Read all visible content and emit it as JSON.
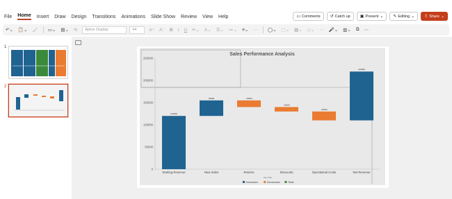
{
  "menu": [
    "File",
    "Home",
    "Insert",
    "Draw",
    "Design",
    "Transitions",
    "Animations",
    "Slide Show",
    "Review",
    "View",
    "Help"
  ],
  "menu_active": "Home",
  "top_right": {
    "comments": "Comments",
    "catchup": "Catch up",
    "present": "Present",
    "editing": "Editing",
    "share": "Share"
  },
  "ribbon": {
    "font_name": "Aptos Display",
    "font_size": "44"
  },
  "thumbnails": [
    {
      "number": "1"
    },
    {
      "number": "2"
    }
  ],
  "colors": {
    "increase": "#1f6391",
    "decrease": "#ea7b32",
    "total": "#3b8a3b",
    "accent": "#c43e1c"
  },
  "chart_data": {
    "type": "bar",
    "subtype": "waterfall",
    "title": "Sales Performance Analysis",
    "xlabel": "Axis Title",
    "categories": [
      "Starting Revenue",
      "New Sales",
      "Returns",
      "Discounts",
      "Operational Costs",
      "Net Revenue"
    ],
    "bars": [
      {
        "category": "Starting Revenue",
        "start": 0,
        "end": 120000,
        "kind": "increase",
        "label": "120000"
      },
      {
        "category": "New Sales",
        "start": 120000,
        "end": 155000,
        "kind": "increase",
        "label": "35000"
      },
      {
        "category": "Returns",
        "start": 155000,
        "end": 140000,
        "kind": "decrease",
        "label": "-15000"
      },
      {
        "category": "Discounts",
        "start": 140000,
        "end": 130000,
        "kind": "decrease",
        "label": "-10000"
      },
      {
        "category": "Operational Costs",
        "start": 130000,
        "end": 110000,
        "kind": "decrease",
        "label": "-20000"
      },
      {
        "category": "Net Revenue",
        "start": 110000,
        "end": 220000,
        "kind": "increase",
        "label": "110000"
      }
    ],
    "yticks": [
      "0",
      "50000",
      "100000",
      "150000",
      "200000",
      "250000"
    ],
    "ylim": [
      0,
      250000
    ],
    "legend": [
      "Increases",
      "Decreases",
      "Total"
    ],
    "legend_position": "bottom",
    "grid": false
  }
}
